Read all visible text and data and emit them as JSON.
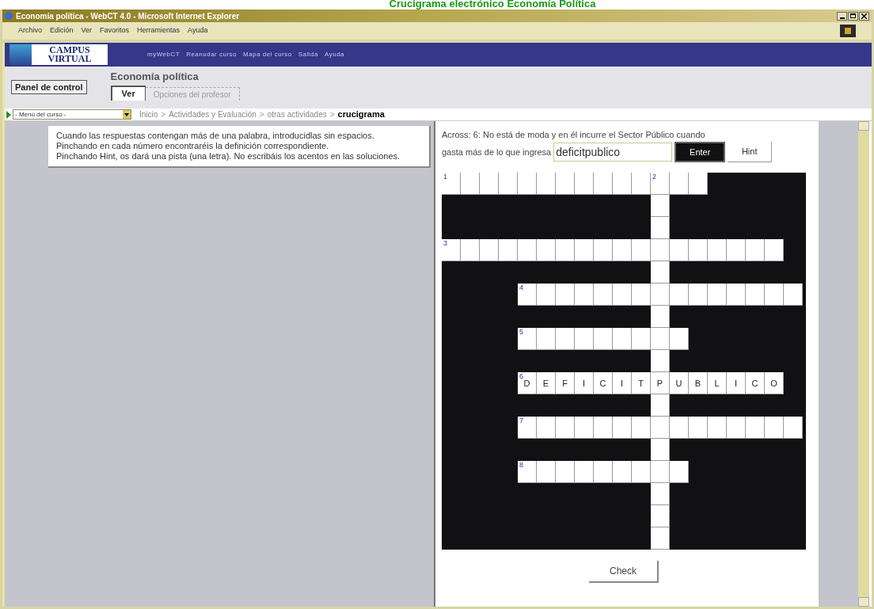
{
  "page_caption": "Crucigrama electrónico Economía Política",
  "window": {
    "title": "Economía política - WebCT 4.0 - Microsoft Internet Explorer"
  },
  "menu_bar": [
    "Archivo",
    "Edición",
    "Ver",
    "Favoritos",
    "Herramientas",
    "Ayuda"
  ],
  "top_nav": {
    "logo": [
      "CAMPUS",
      "VIRTUAL"
    ],
    "links": [
      "myWebCT",
      "Reanudar curso",
      "Mapa del curso",
      "Salida",
      "Ayuda"
    ]
  },
  "control_panel_button": "Panel de control",
  "course_title": "Economía política",
  "tabs": [
    {
      "label": "Ver",
      "selected": true
    },
    {
      "label": "Opciones del profesor",
      "selected": false
    }
  ],
  "course_menu": {
    "value": "- Menú del curso -"
  },
  "breadcrumb": {
    "separator": ">",
    "items": [
      {
        "label": "Inicio",
        "current": false
      },
      {
        "label": "Actividades y Evaluación",
        "current": false
      },
      {
        "label": "otras actividades",
        "current": false
      },
      {
        "label": "crucigrama",
        "current": true
      }
    ]
  },
  "instructions": [
    "Cuando las respuestas contengan más de una palabra, introducidlas sin espacios.",
    "Pinchando en cada número encontraréis la definición correspondiente.",
    "Pinchando Hint, os dará una pista (una letra). No escribáis los acentos en las soluciones."
  ],
  "clue": {
    "lines": [
      "Across: 6: No está de moda y en él incurre el Sector Público cuando",
      "gasta más de lo que ingresa"
    ],
    "answer_value": "deficitpublico"
  },
  "buttons": {
    "enter": "Enter",
    "hint": "Hint",
    "check": "Check"
  },
  "crossword": {
    "rows": [
      [
        {
          "kind": "blank",
          "number": "1"
        },
        {
          "kind": "blank"
        },
        {
          "kind": "blank"
        },
        {
          "kind": "blank"
        },
        {
          "kind": "blank"
        },
        {
          "kind": "blank"
        },
        {
          "kind": "blank"
        },
        {
          "kind": "blank"
        },
        {
          "kind": "blank"
        },
        {
          "kind": "blank"
        },
        {
          "kind": "blank"
        },
        {
          "kind": "blank",
          "number": "2"
        },
        {
          "kind": "blank"
        },
        {
          "kind": "blank"
        },
        {
          "kind": "block"
        },
        {
          "kind": "block"
        },
        {
          "kind": "block"
        },
        {
          "kind": "block"
        },
        {
          "kind": "block"
        }
      ],
      [
        {
          "kind": "block"
        },
        {
          "kind": "block"
        },
        {
          "kind": "block"
        },
        {
          "kind": "block"
        },
        {
          "kind": "block"
        },
        {
          "kind": "block"
        },
        {
          "kind": "block"
        },
        {
          "kind": "block"
        },
        {
          "kind": "block"
        },
        {
          "kind": "block"
        },
        {
          "kind": "block"
        },
        {
          "kind": "blank"
        },
        {
          "kind": "block"
        },
        {
          "kind": "block"
        },
        {
          "kind": "block"
        },
        {
          "kind": "block"
        },
        {
          "kind": "block"
        },
        {
          "kind": "block"
        },
        {
          "kind": "block"
        }
      ],
      [
        {
          "kind": "block"
        },
        {
          "kind": "block"
        },
        {
          "kind": "block"
        },
        {
          "kind": "block"
        },
        {
          "kind": "block"
        },
        {
          "kind": "block"
        },
        {
          "kind": "block"
        },
        {
          "kind": "block"
        },
        {
          "kind": "block"
        },
        {
          "kind": "block"
        },
        {
          "kind": "block"
        },
        {
          "kind": "blank"
        },
        {
          "kind": "block"
        },
        {
          "kind": "block"
        },
        {
          "kind": "block"
        },
        {
          "kind": "block"
        },
        {
          "kind": "block"
        },
        {
          "kind": "block"
        },
        {
          "kind": "block"
        }
      ],
      [
        {
          "kind": "blank",
          "number": "3"
        },
        {
          "kind": "blank"
        },
        {
          "kind": "blank"
        },
        {
          "kind": "blank"
        },
        {
          "kind": "blank"
        },
        {
          "kind": "blank"
        },
        {
          "kind": "blank"
        },
        {
          "kind": "blank"
        },
        {
          "kind": "blank"
        },
        {
          "kind": "blank"
        },
        {
          "kind": "blank"
        },
        {
          "kind": "blank"
        },
        {
          "kind": "blank"
        },
        {
          "kind": "blank"
        },
        {
          "kind": "blank"
        },
        {
          "kind": "blank"
        },
        {
          "kind": "blank"
        },
        {
          "kind": "blank"
        },
        {
          "kind": "block"
        }
      ],
      [
        {
          "kind": "block"
        },
        {
          "kind": "block"
        },
        {
          "kind": "block"
        },
        {
          "kind": "block"
        },
        {
          "kind": "block"
        },
        {
          "kind": "block"
        },
        {
          "kind": "block"
        },
        {
          "kind": "block"
        },
        {
          "kind": "block"
        },
        {
          "kind": "block"
        },
        {
          "kind": "block"
        },
        {
          "kind": "blank"
        },
        {
          "kind": "block"
        },
        {
          "kind": "block"
        },
        {
          "kind": "block"
        },
        {
          "kind": "block"
        },
        {
          "kind": "block"
        },
        {
          "kind": "block"
        },
        {
          "kind": "block"
        }
      ],
      [
        {
          "kind": "block"
        },
        {
          "kind": "block"
        },
        {
          "kind": "block"
        },
        {
          "kind": "block"
        },
        {
          "kind": "blank",
          "number": "4"
        },
        {
          "kind": "blank"
        },
        {
          "kind": "blank"
        },
        {
          "kind": "blank"
        },
        {
          "kind": "blank"
        },
        {
          "kind": "blank"
        },
        {
          "kind": "blank"
        },
        {
          "kind": "blank"
        },
        {
          "kind": "blank"
        },
        {
          "kind": "blank"
        },
        {
          "kind": "blank"
        },
        {
          "kind": "blank"
        },
        {
          "kind": "blank"
        },
        {
          "kind": "blank"
        },
        {
          "kind": "blank"
        }
      ],
      [
        {
          "kind": "block"
        },
        {
          "kind": "block"
        },
        {
          "kind": "block"
        },
        {
          "kind": "block"
        },
        {
          "kind": "block"
        },
        {
          "kind": "block"
        },
        {
          "kind": "block"
        },
        {
          "kind": "block"
        },
        {
          "kind": "block"
        },
        {
          "kind": "block"
        },
        {
          "kind": "block"
        },
        {
          "kind": "blank"
        },
        {
          "kind": "block"
        },
        {
          "kind": "block"
        },
        {
          "kind": "block"
        },
        {
          "kind": "block"
        },
        {
          "kind": "block"
        },
        {
          "kind": "block"
        },
        {
          "kind": "block"
        }
      ],
      [
        {
          "kind": "block"
        },
        {
          "kind": "block"
        },
        {
          "kind": "block"
        },
        {
          "kind": "block"
        },
        {
          "kind": "blank",
          "number": "5"
        },
        {
          "kind": "blank"
        },
        {
          "kind": "blank"
        },
        {
          "kind": "blank"
        },
        {
          "kind": "blank"
        },
        {
          "kind": "blank"
        },
        {
          "kind": "blank"
        },
        {
          "kind": "blank"
        },
        {
          "kind": "blank"
        },
        {
          "kind": "block"
        },
        {
          "kind": "block"
        },
        {
          "kind": "block"
        },
        {
          "kind": "block"
        },
        {
          "kind": "block"
        },
        {
          "kind": "block"
        }
      ],
      [
        {
          "kind": "block"
        },
        {
          "kind": "block"
        },
        {
          "kind": "block"
        },
        {
          "kind": "block"
        },
        {
          "kind": "block"
        },
        {
          "kind": "block"
        },
        {
          "kind": "block"
        },
        {
          "kind": "block"
        },
        {
          "kind": "block"
        },
        {
          "kind": "block"
        },
        {
          "kind": "block"
        },
        {
          "kind": "blank"
        },
        {
          "kind": "block"
        },
        {
          "kind": "block"
        },
        {
          "kind": "block"
        },
        {
          "kind": "block"
        },
        {
          "kind": "block"
        },
        {
          "kind": "block"
        },
        {
          "kind": "block"
        }
      ],
      [
        {
          "kind": "block"
        },
        {
          "kind": "block"
        },
        {
          "kind": "block"
        },
        {
          "kind": "block"
        },
        {
          "kind": "letter",
          "letter": "D",
          "number": "6"
        },
        {
          "kind": "letter",
          "letter": "E"
        },
        {
          "kind": "letter",
          "letter": "F"
        },
        {
          "kind": "letter",
          "letter": "I"
        },
        {
          "kind": "letter",
          "letter": "C"
        },
        {
          "kind": "letter",
          "letter": "I"
        },
        {
          "kind": "letter",
          "letter": "T"
        },
        {
          "kind": "letter",
          "letter": "P"
        },
        {
          "kind": "letter",
          "letter": "U"
        },
        {
          "kind": "letter",
          "letter": "B"
        },
        {
          "kind": "letter",
          "letter": "L"
        },
        {
          "kind": "letter",
          "letter": "I"
        },
        {
          "kind": "letter",
          "letter": "C"
        },
        {
          "kind": "letter",
          "letter": "O"
        },
        {
          "kind": "block"
        }
      ],
      [
        {
          "kind": "block"
        },
        {
          "kind": "block"
        },
        {
          "kind": "block"
        },
        {
          "kind": "block"
        },
        {
          "kind": "block"
        },
        {
          "kind": "block"
        },
        {
          "kind": "block"
        },
        {
          "kind": "block"
        },
        {
          "kind": "block"
        },
        {
          "kind": "block"
        },
        {
          "kind": "block"
        },
        {
          "kind": "blank"
        },
        {
          "kind": "block"
        },
        {
          "kind": "block"
        },
        {
          "kind": "block"
        },
        {
          "kind": "block"
        },
        {
          "kind": "block"
        },
        {
          "kind": "block"
        },
        {
          "kind": "block"
        }
      ],
      [
        {
          "kind": "block"
        },
        {
          "kind": "block"
        },
        {
          "kind": "block"
        },
        {
          "kind": "block"
        },
        {
          "kind": "blank",
          "number": "7"
        },
        {
          "kind": "blank"
        },
        {
          "kind": "blank"
        },
        {
          "kind": "blank"
        },
        {
          "kind": "blank"
        },
        {
          "kind": "blank"
        },
        {
          "kind": "blank"
        },
        {
          "kind": "blank"
        },
        {
          "kind": "blank"
        },
        {
          "kind": "blank"
        },
        {
          "kind": "blank"
        },
        {
          "kind": "blank"
        },
        {
          "kind": "blank"
        },
        {
          "kind": "blank"
        },
        {
          "kind": "blank"
        }
      ],
      [
        {
          "kind": "block"
        },
        {
          "kind": "block"
        },
        {
          "kind": "block"
        },
        {
          "kind": "block"
        },
        {
          "kind": "block"
        },
        {
          "kind": "block"
        },
        {
          "kind": "block"
        },
        {
          "kind": "block"
        },
        {
          "kind": "block"
        },
        {
          "kind": "block"
        },
        {
          "kind": "block"
        },
        {
          "kind": "blank"
        },
        {
          "kind": "block"
        },
        {
          "kind": "block"
        },
        {
          "kind": "block"
        },
        {
          "kind": "block"
        },
        {
          "kind": "block"
        },
        {
          "kind": "block"
        },
        {
          "kind": "block"
        }
      ],
      [
        {
          "kind": "block"
        },
        {
          "kind": "block"
        },
        {
          "kind": "block"
        },
        {
          "kind": "block"
        },
        {
          "kind": "blank",
          "number": "8"
        },
        {
          "kind": "blank"
        },
        {
          "kind": "blank"
        },
        {
          "kind": "blank"
        },
        {
          "kind": "blank"
        },
        {
          "kind": "blank"
        },
        {
          "kind": "blank"
        },
        {
          "kind": "blank"
        },
        {
          "kind": "blank"
        },
        {
          "kind": "block"
        },
        {
          "kind": "block"
        },
        {
          "kind": "block"
        },
        {
          "kind": "block"
        },
        {
          "kind": "block"
        },
        {
          "kind": "block"
        }
      ],
      [
        {
          "kind": "block"
        },
        {
          "kind": "block"
        },
        {
          "kind": "block"
        },
        {
          "kind": "block"
        },
        {
          "kind": "block"
        },
        {
          "kind": "block"
        },
        {
          "kind": "block"
        },
        {
          "kind": "block"
        },
        {
          "kind": "block"
        },
        {
          "kind": "block"
        },
        {
          "kind": "block"
        },
        {
          "kind": "blank"
        },
        {
          "kind": "block"
        },
        {
          "kind": "block"
        },
        {
          "kind": "block"
        },
        {
          "kind": "block"
        },
        {
          "kind": "block"
        },
        {
          "kind": "block"
        },
        {
          "kind": "block"
        }
      ],
      [
        {
          "kind": "block"
        },
        {
          "kind": "block"
        },
        {
          "kind": "block"
        },
        {
          "kind": "block"
        },
        {
          "kind": "block"
        },
        {
          "kind": "block"
        },
        {
          "kind": "block"
        },
        {
          "kind": "block"
        },
        {
          "kind": "block"
        },
        {
          "kind": "block"
        },
        {
          "kind": "block"
        },
        {
          "kind": "blank"
        },
        {
          "kind": "block"
        },
        {
          "kind": "block"
        },
        {
          "kind": "block"
        },
        {
          "kind": "block"
        },
        {
          "kind": "block"
        },
        {
          "kind": "block"
        },
        {
          "kind": "block"
        }
      ],
      [
        {
          "kind": "block"
        },
        {
          "kind": "block"
        },
        {
          "kind": "block"
        },
        {
          "kind": "block"
        },
        {
          "kind": "block"
        },
        {
          "kind": "block"
        },
        {
          "kind": "block"
        },
        {
          "kind": "block"
        },
        {
          "kind": "block"
        },
        {
          "kind": "block"
        },
        {
          "kind": "block"
        },
        {
          "kind": "blank"
        },
        {
          "kind": "block"
        },
        {
          "kind": "block"
        },
        {
          "kind": "block"
        },
        {
          "kind": "block"
        },
        {
          "kind": "block"
        },
        {
          "kind": "block"
        },
        {
          "kind": "block"
        }
      ]
    ]
  }
}
